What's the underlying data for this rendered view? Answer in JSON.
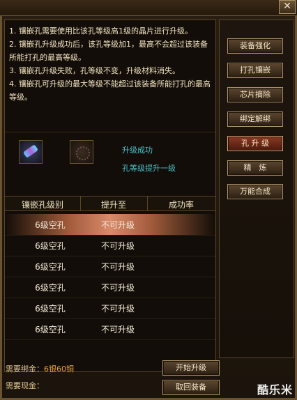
{
  "window": {
    "close_label": "✕"
  },
  "description": [
    "1. 镶嵌孔需要使用比该孔等级高1级的晶片进行升级。",
    "2. 镶嵌孔升级成功后，该孔等级加1，最高不会超过该装备所能打孔的最高等级。",
    "3. 镶嵌孔升级失败，孔等级不变，升级材料消失。",
    "4. 镶嵌孔可升级的最大等级不能超过该装备所能打孔的最高等级。"
  ],
  "result": {
    "line1": "升级成功",
    "line2": "孔等级提升一级"
  },
  "table": {
    "headers": [
      "镶嵌孔级别",
      "提升至",
      "成功率"
    ],
    "rows": [
      {
        "level": "6级空孔",
        "target": "不可升级",
        "rate": ""
      },
      {
        "level": "6级空孔",
        "target": "不可升级",
        "rate": ""
      },
      {
        "level": "6级空孔",
        "target": "不可升级",
        "rate": ""
      },
      {
        "level": "6级空孔",
        "target": "不可升级",
        "rate": ""
      },
      {
        "level": "6级空孔",
        "target": "不可升级",
        "rate": ""
      },
      {
        "level": "6级空孔",
        "target": "不可升级",
        "rate": ""
      }
    ]
  },
  "footer": {
    "bind_gold_label": "需要绑金：",
    "bind_gold_value": "6银60铜",
    "coin_label": "需要现金：",
    "coin_value": ""
  },
  "buttons": {
    "start_upgrade": "开始升级",
    "retrieve": "取回装备"
  },
  "side_menu": [
    {
      "label": "装备强化"
    },
    {
      "label": "打孔镶嵌"
    },
    {
      "label": "芯片摘除"
    },
    {
      "label": "绑定解绑"
    },
    {
      "label": "孔 升 级"
    },
    {
      "label": "精　炼"
    },
    {
      "label": "万能合成"
    }
  ],
  "watermark": "酷乐米"
}
